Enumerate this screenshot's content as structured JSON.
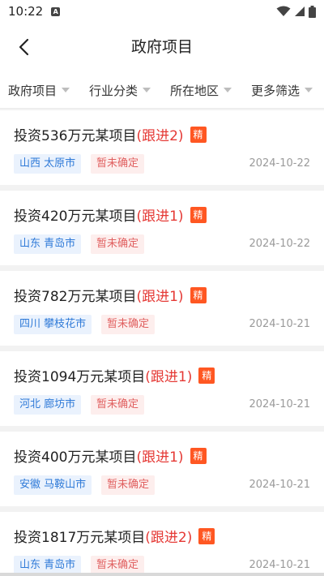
{
  "status_bar": {
    "time": "10:22",
    "notification_icon": "A"
  },
  "header": {
    "title": "政府项目"
  },
  "filters": [
    {
      "label": "政府项目"
    },
    {
      "label": "行业分类"
    },
    {
      "label": "所在地区"
    },
    {
      "label": "更多筛选"
    }
  ],
  "projects": [
    {
      "title": "投资536万元某项目",
      "follow": "(跟进2)",
      "badge": "精",
      "location": "山西 太原市",
      "status": "暂未确定",
      "date": "2024-10-22"
    },
    {
      "title": "投资420万元某项目",
      "follow": "(跟进1)",
      "badge": "精",
      "location": "山东 青岛市",
      "status": "暂未确定",
      "date": "2024-10-22"
    },
    {
      "title": "投资782万元某项目",
      "follow": "(跟进1)",
      "badge": "精",
      "location": "四川 攀枝花市",
      "status": "暂未确定",
      "date": "2024-10-21"
    },
    {
      "title": "投资1094万元某项目",
      "follow": "(跟进1)",
      "badge": "精",
      "location": "河北 廊坊市",
      "status": "暂未确定",
      "date": "2024-10-21"
    },
    {
      "title": "投资400万元某项目",
      "follow": "(跟进1)",
      "badge": "精",
      "location": "安徽 马鞍山市",
      "status": "暂未确定",
      "date": "2024-10-21"
    },
    {
      "title": "投资1817万元某项目",
      "follow": "(跟进2)",
      "badge": "精",
      "location": "山东 青岛市",
      "status": "暂未确定",
      "date": "2024-10-21"
    }
  ],
  "icons": {
    "back": "chevron-left-icon",
    "filter_arrow": "triangle-down-icon",
    "wifi": "wifi-icon",
    "signal": "signal-icon",
    "battery": "battery-icon"
  },
  "colors": {
    "follow_text": "#e53935",
    "badge_bg": "#ff5722",
    "location_text": "#2f7ad8",
    "location_bg": "#eaf2fd",
    "status_text": "#e06060",
    "status_bg": "#fdeeed"
  }
}
